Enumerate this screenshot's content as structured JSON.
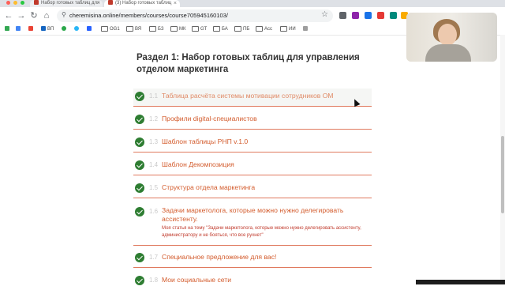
{
  "browser": {
    "tabs": [
      {
        "label": "Набор готовых таблиц для"
      },
      {
        "label": "(3) Набор готовых таблиц"
      }
    ],
    "url": "cheremisina.online/members/courses/course705945160103/",
    "bookmarks": [
      "ВП",
      "OG1",
      "ВЯ",
      "БЗ",
      "МК",
      "GT",
      "БА",
      "ПБ",
      "Acc",
      "ИИ"
    ]
  },
  "section": {
    "title": "Раздел 1: Набор готовых таблиц для управления отделом маркетинга"
  },
  "lessons": [
    {
      "num": "1.1",
      "title": "Таблица расчёта системы мотивации сотрудников ОМ"
    },
    {
      "num": "1.2",
      "title": "Профили digital-специалистов"
    },
    {
      "num": "1.3",
      "title": "Шаблон таблицы РНП v.1.0"
    },
    {
      "num": "1.4",
      "title": "Шаблон Декомпозиция"
    },
    {
      "num": "1.5",
      "title": "Структура отдела маркетинга"
    },
    {
      "num": "1.6",
      "title": "Задачи маркетолога, которые можно нужно делегировать ассистенту.",
      "desc": "Моя статья на тему \"Задачи маркетолога, которые можно нужно делегировать ассистенту, администратору и не бояться, что все рухнет\""
    },
    {
      "num": "1.7",
      "title": "Специальное предложение для вас!"
    },
    {
      "num": "1.8",
      "title": "Мои социальные сети"
    }
  ],
  "colors": {
    "accent": "#d35b2c",
    "check": "#2e7d32",
    "divider": "#e07a5f"
  }
}
